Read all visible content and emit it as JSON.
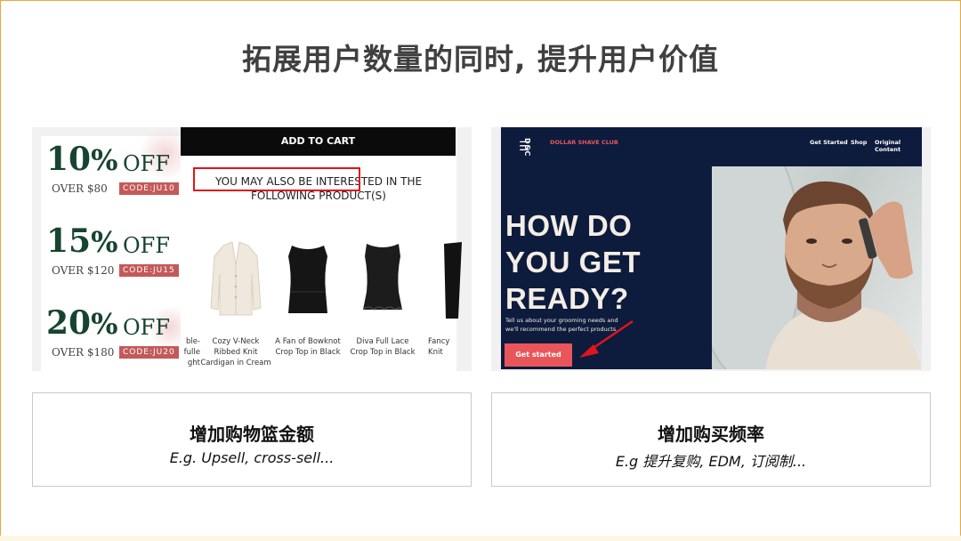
{
  "slide_title": "拓展用户数量的同时, 提升用户价值",
  "left_panel": {
    "coupons": [
      {
        "big": "10",
        "pct": "%",
        "off": "OFF",
        "over": "OVER $80",
        "code": "CODE:JU10"
      },
      {
        "big": "15",
        "pct": "%",
        "off": "OFF",
        "over": "OVER $120",
        "code": "CODE:JU15"
      },
      {
        "big": "20",
        "pct": "%",
        "off": "OFF",
        "over": "OVER $180",
        "code": "CODE:JU20"
      }
    ],
    "add_to_cart": "ADD TO CART",
    "interested_text": "YOU MAY ALSO BE INTERESTED IN THE FOLLOWING PRODUCT(S)",
    "products": [
      {
        "caption": "ble-\nfulle\nght",
        "icon": "garment-icon"
      },
      {
        "caption": "Cozy V-Neck Ribbed Knit Cardigan in Cream",
        "icon": "cardigan-icon"
      },
      {
        "caption": "A Fan of Bowknot Crop Top in Black",
        "icon": "crop-top-icon"
      },
      {
        "caption": "Diva Full Lace Crop Top in Black",
        "icon": "lace-top-icon"
      },
      {
        "caption": "Fancy \nKnit",
        "icon": "knit-icon"
      }
    ],
    "highlight_color": "#e0141b"
  },
  "right_panel": {
    "logo_mark": "DSC",
    "brand": "DOLLAR SHAVE CLUB",
    "nav": [
      "Get Started",
      "Shop",
      "Original Content"
    ],
    "headline": [
      "HOW DO",
      "YOU GET",
      "READY?"
    ],
    "subtext": "Tell us about your grooming needs and we'll recommend the perfect products.",
    "cta": "Get started",
    "bg_color": "#0d1b3d",
    "accent_color": "#e8565a",
    "arrow_color": "#e0141b"
  },
  "cards": [
    {
      "heading": "增加购物篮金额",
      "subtitle": "E.g. Upsell, cross-sell..."
    },
    {
      "heading": "增加购买频率",
      "subtitle": "E.g 提升复购, EDM, 订阅制..."
    }
  ]
}
